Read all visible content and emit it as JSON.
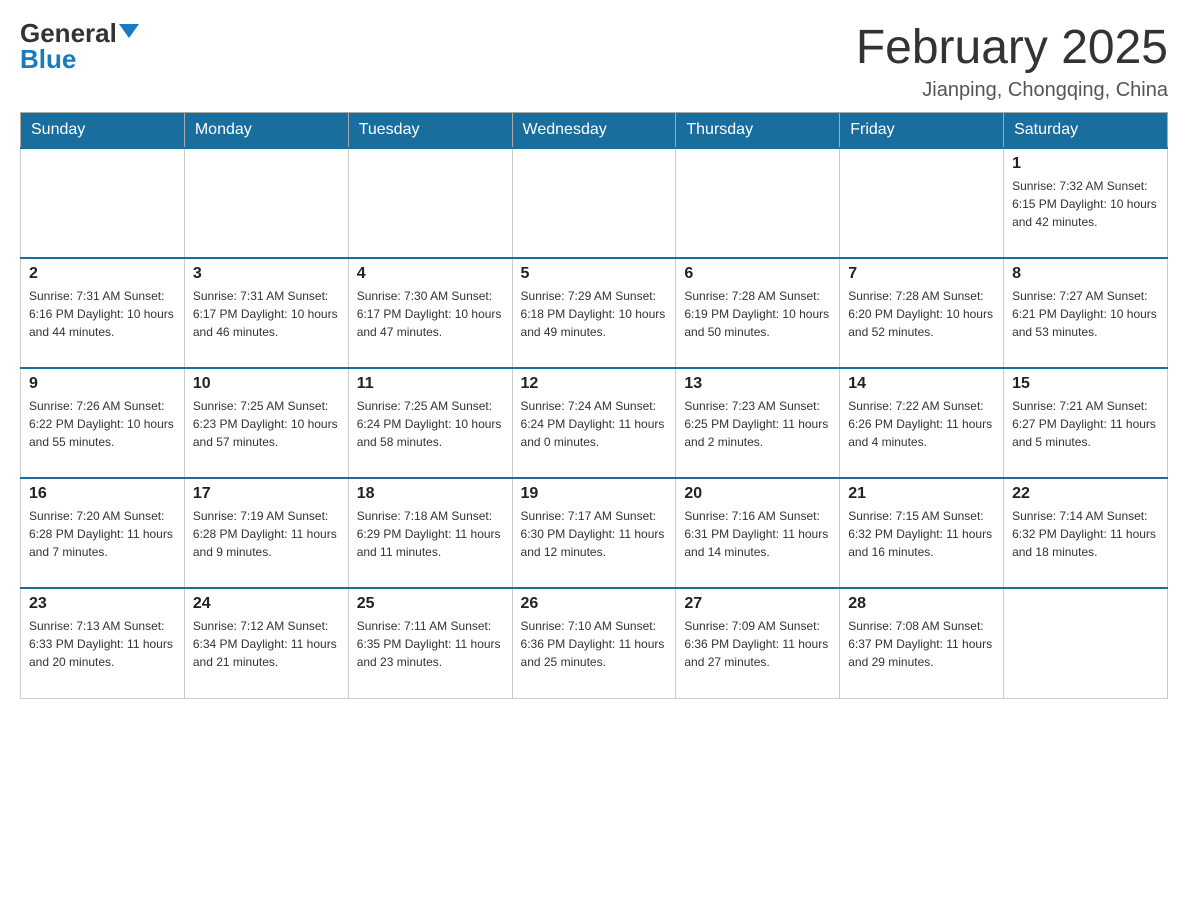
{
  "header": {
    "logo_general": "General",
    "logo_blue": "Blue",
    "month_title": "February 2025",
    "location": "Jianping, Chongqing, China"
  },
  "days_of_week": [
    "Sunday",
    "Monday",
    "Tuesday",
    "Wednesday",
    "Thursday",
    "Friday",
    "Saturday"
  ],
  "weeks": [
    [
      {
        "day": "",
        "info": ""
      },
      {
        "day": "",
        "info": ""
      },
      {
        "day": "",
        "info": ""
      },
      {
        "day": "",
        "info": ""
      },
      {
        "day": "",
        "info": ""
      },
      {
        "day": "",
        "info": ""
      },
      {
        "day": "1",
        "info": "Sunrise: 7:32 AM\nSunset: 6:15 PM\nDaylight: 10 hours\nand 42 minutes."
      }
    ],
    [
      {
        "day": "2",
        "info": "Sunrise: 7:31 AM\nSunset: 6:16 PM\nDaylight: 10 hours\nand 44 minutes."
      },
      {
        "day": "3",
        "info": "Sunrise: 7:31 AM\nSunset: 6:17 PM\nDaylight: 10 hours\nand 46 minutes."
      },
      {
        "day": "4",
        "info": "Sunrise: 7:30 AM\nSunset: 6:17 PM\nDaylight: 10 hours\nand 47 minutes."
      },
      {
        "day": "5",
        "info": "Sunrise: 7:29 AM\nSunset: 6:18 PM\nDaylight: 10 hours\nand 49 minutes."
      },
      {
        "day": "6",
        "info": "Sunrise: 7:28 AM\nSunset: 6:19 PM\nDaylight: 10 hours\nand 50 minutes."
      },
      {
        "day": "7",
        "info": "Sunrise: 7:28 AM\nSunset: 6:20 PM\nDaylight: 10 hours\nand 52 minutes."
      },
      {
        "day": "8",
        "info": "Sunrise: 7:27 AM\nSunset: 6:21 PM\nDaylight: 10 hours\nand 53 minutes."
      }
    ],
    [
      {
        "day": "9",
        "info": "Sunrise: 7:26 AM\nSunset: 6:22 PM\nDaylight: 10 hours\nand 55 minutes."
      },
      {
        "day": "10",
        "info": "Sunrise: 7:25 AM\nSunset: 6:23 PM\nDaylight: 10 hours\nand 57 minutes."
      },
      {
        "day": "11",
        "info": "Sunrise: 7:25 AM\nSunset: 6:24 PM\nDaylight: 10 hours\nand 58 minutes."
      },
      {
        "day": "12",
        "info": "Sunrise: 7:24 AM\nSunset: 6:24 PM\nDaylight: 11 hours\nand 0 minutes."
      },
      {
        "day": "13",
        "info": "Sunrise: 7:23 AM\nSunset: 6:25 PM\nDaylight: 11 hours\nand 2 minutes."
      },
      {
        "day": "14",
        "info": "Sunrise: 7:22 AM\nSunset: 6:26 PM\nDaylight: 11 hours\nand 4 minutes."
      },
      {
        "day": "15",
        "info": "Sunrise: 7:21 AM\nSunset: 6:27 PM\nDaylight: 11 hours\nand 5 minutes."
      }
    ],
    [
      {
        "day": "16",
        "info": "Sunrise: 7:20 AM\nSunset: 6:28 PM\nDaylight: 11 hours\nand 7 minutes."
      },
      {
        "day": "17",
        "info": "Sunrise: 7:19 AM\nSunset: 6:28 PM\nDaylight: 11 hours\nand 9 minutes."
      },
      {
        "day": "18",
        "info": "Sunrise: 7:18 AM\nSunset: 6:29 PM\nDaylight: 11 hours\nand 11 minutes."
      },
      {
        "day": "19",
        "info": "Sunrise: 7:17 AM\nSunset: 6:30 PM\nDaylight: 11 hours\nand 12 minutes."
      },
      {
        "day": "20",
        "info": "Sunrise: 7:16 AM\nSunset: 6:31 PM\nDaylight: 11 hours\nand 14 minutes."
      },
      {
        "day": "21",
        "info": "Sunrise: 7:15 AM\nSunset: 6:32 PM\nDaylight: 11 hours\nand 16 minutes."
      },
      {
        "day": "22",
        "info": "Sunrise: 7:14 AM\nSunset: 6:32 PM\nDaylight: 11 hours\nand 18 minutes."
      }
    ],
    [
      {
        "day": "23",
        "info": "Sunrise: 7:13 AM\nSunset: 6:33 PM\nDaylight: 11 hours\nand 20 minutes."
      },
      {
        "day": "24",
        "info": "Sunrise: 7:12 AM\nSunset: 6:34 PM\nDaylight: 11 hours\nand 21 minutes."
      },
      {
        "day": "25",
        "info": "Sunrise: 7:11 AM\nSunset: 6:35 PM\nDaylight: 11 hours\nand 23 minutes."
      },
      {
        "day": "26",
        "info": "Sunrise: 7:10 AM\nSunset: 6:36 PM\nDaylight: 11 hours\nand 25 minutes."
      },
      {
        "day": "27",
        "info": "Sunrise: 7:09 AM\nSunset: 6:36 PM\nDaylight: 11 hours\nand 27 minutes."
      },
      {
        "day": "28",
        "info": "Sunrise: 7:08 AM\nSunset: 6:37 PM\nDaylight: 11 hours\nand 29 minutes."
      },
      {
        "day": "",
        "info": ""
      }
    ]
  ]
}
